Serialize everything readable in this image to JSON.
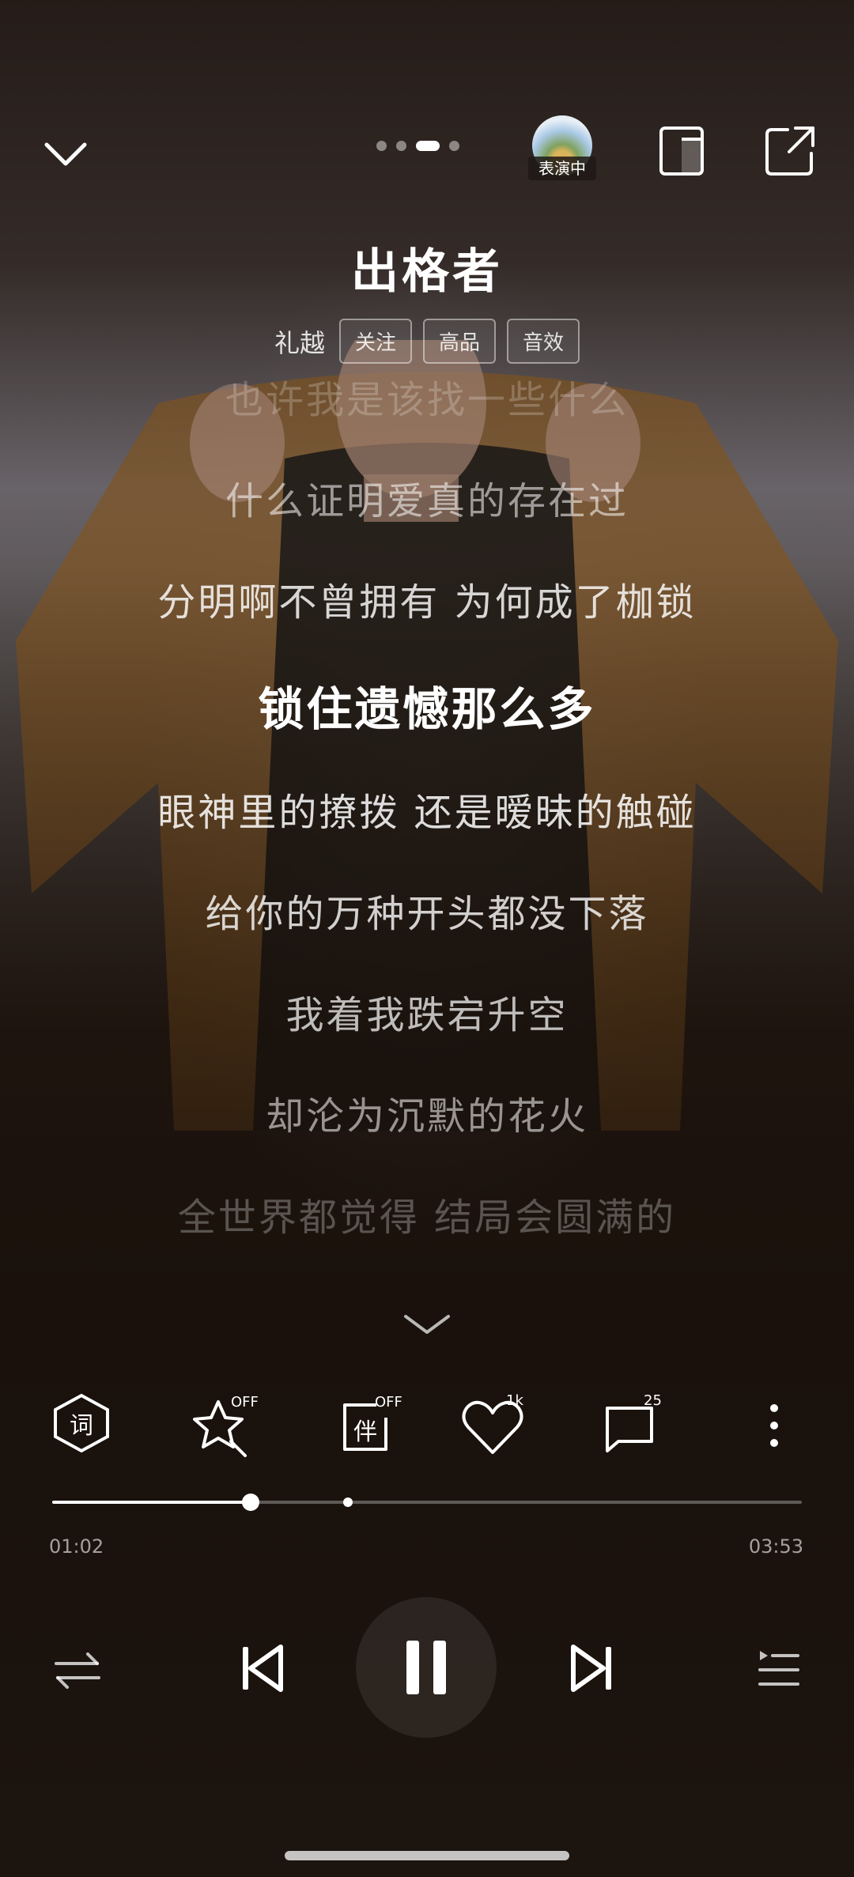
{
  "header": {
    "perform_badge": "表演中",
    "page_count": 4,
    "active_page": 3
  },
  "song": {
    "title": "出格者",
    "artist": "礼越",
    "tags": [
      "关注",
      "高品",
      "音效"
    ]
  },
  "lyrics": [
    {
      "text": "也许我是该找一些什么",
      "state": "faded"
    },
    {
      "text": "什么证明爱真的存在过",
      "state": "dim"
    },
    {
      "text": "分明啊不曾拥有 为何成了枷锁",
      "state": "normal"
    },
    {
      "text": "锁住遗憾那么多",
      "state": "current"
    },
    {
      "text": "眼神里的撩拨 还是暧昧的触碰",
      "state": "normal"
    },
    {
      "text": "给你的万种开头都没下落",
      "state": "normal"
    },
    {
      "text": "我着我跌宕升空",
      "state": "normal"
    },
    {
      "text": "却沦为沉默的花火",
      "state": "dim"
    },
    {
      "text": "全世界都觉得 结局会圆满的",
      "state": "faded"
    }
  ],
  "functions": {
    "lyrics_label": "词",
    "favorite_badge": "OFF",
    "accompany_label": "伴",
    "accompany_badge": "OFF",
    "like_count": "1k",
    "comment_count": "25"
  },
  "playback": {
    "current_time": "01:02",
    "total_time": "03:53",
    "progress": 0.265,
    "marker_position": 0.395,
    "state": "playing"
  },
  "icons": {
    "collapse": "chevron-down-icon",
    "device": "device-icon",
    "share": "share-icon",
    "expand": "chevron-down-icon",
    "play_mode": "shuffle-icon",
    "previous": "previous-icon",
    "pause": "pause-icon",
    "next": "next-icon",
    "playlist": "playlist-icon",
    "more": "more-icon"
  }
}
